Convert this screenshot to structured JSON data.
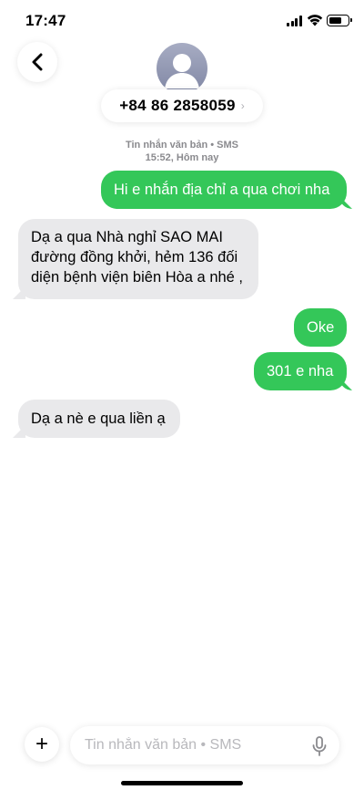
{
  "status_bar": {
    "time": "17:47"
  },
  "header": {
    "contact": "+84 86 2858059",
    "chevron": "›"
  },
  "meta": {
    "line1": "Tin nhắn văn bản • SMS",
    "line2": "15:52, Hôm nay"
  },
  "messages": [
    {
      "direction": "sent",
      "text": "Hi e nhắn địa chỉ a qua chơi nha"
    },
    {
      "direction": "received",
      "text": "Dạ a qua Nhà nghỉ SAO MAI đường đồng khởi, hẻm 136 đối diện bệnh viện biên Hòa a nhé ,"
    },
    {
      "direction": "sent",
      "text": "Oke"
    },
    {
      "direction": "sent",
      "text": "301 e nha"
    },
    {
      "direction": "received",
      "text": "Dạ a nè e qua liền ạ"
    }
  ],
  "composer": {
    "placeholder": "Tin nhắn văn bản • SMS",
    "plus": "+"
  },
  "icons": {
    "back": "chevron-left-icon",
    "avatar": "person-icon",
    "mic": "microphone-icon"
  },
  "colors": {
    "sent": "#34c759",
    "received": "#e9e9eb"
  }
}
